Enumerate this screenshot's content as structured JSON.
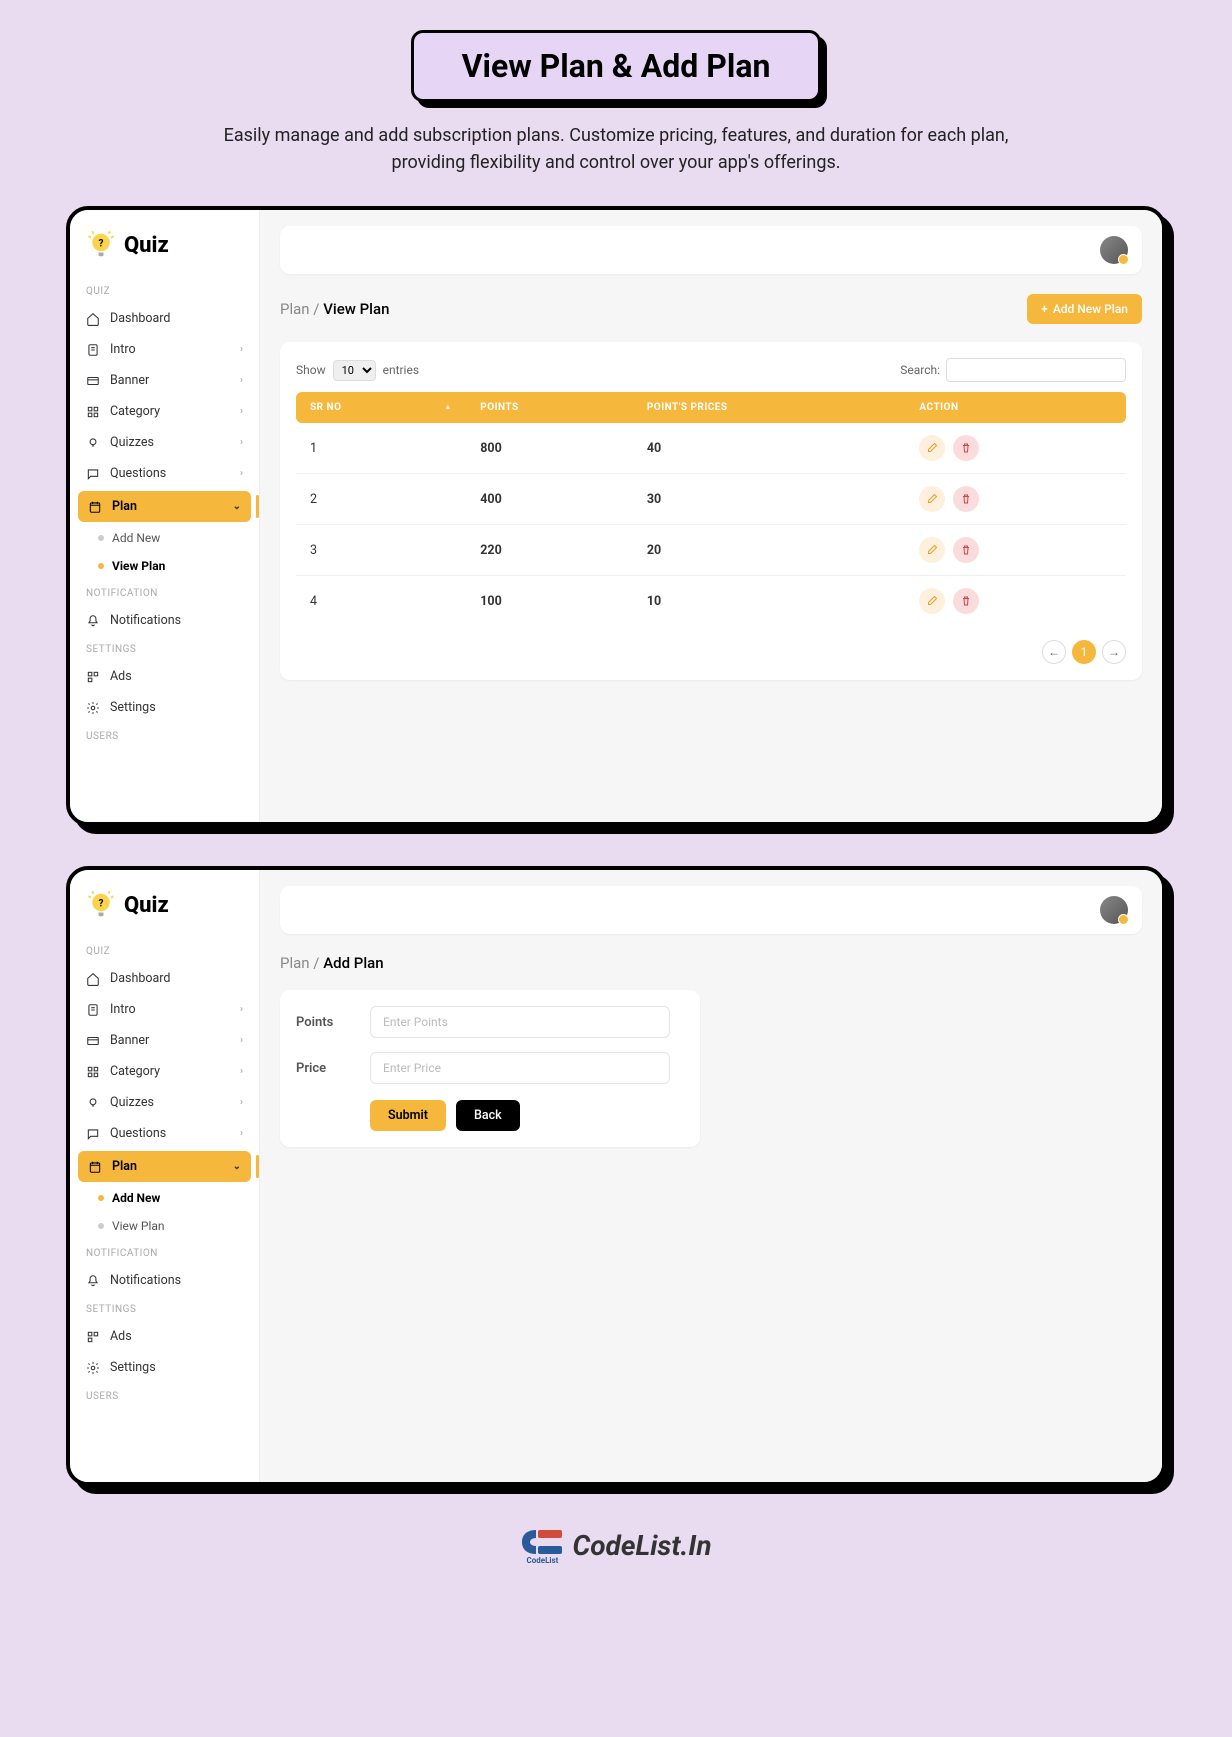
{
  "page_title": "View Plan & Add Plan",
  "page_subtitle": "Easily manage and add subscription plans. Customize pricing, features, and duration for each plan, providing flexibility and control over your app's offerings.",
  "app_name": "Quiz",
  "sidebar": {
    "sections": {
      "quiz_label": "QUIZ",
      "notification_label": "NOTIFICATION",
      "settings_label": "SETTINGS",
      "users_label": "USERS"
    },
    "items": {
      "dashboard": "Dashboard",
      "intro": "Intro",
      "banner": "Banner",
      "category": "Category",
      "quizzes": "Quizzes",
      "questions": "Questions",
      "plan": "Plan",
      "add_new": "Add New",
      "view_plan": "View Plan",
      "notifications": "Notifications",
      "ads": "Ads",
      "settings": "Settings"
    }
  },
  "view_panel": {
    "breadcrumb_root": "Plan",
    "breadcrumb_current": "View Plan",
    "add_button": "Add New Plan",
    "show_label": "Show",
    "show_value": "10",
    "entries_label": "entries",
    "search_label": "Search:",
    "columns": {
      "sr": "SR NO",
      "points": "POINTS",
      "prices": "POINT'S PRICES",
      "action": "ACTION"
    },
    "rows": [
      {
        "sr": "1",
        "points": "800",
        "price": "40"
      },
      {
        "sr": "2",
        "points": "400",
        "price": "30"
      },
      {
        "sr": "3",
        "points": "220",
        "price": "20"
      },
      {
        "sr": "4",
        "points": "100",
        "price": "10"
      }
    ],
    "pagination": {
      "prev": "←",
      "page": "1",
      "next": "→"
    }
  },
  "add_panel": {
    "breadcrumb_root": "Plan",
    "breadcrumb_current": "Add Plan",
    "points_label": "Points",
    "points_placeholder": "Enter Points",
    "price_label": "Price",
    "price_placeholder": "Enter Price",
    "submit": "Submit",
    "back": "Back"
  },
  "footer": {
    "brand": "CodeList.In",
    "sub": "CodeList"
  }
}
